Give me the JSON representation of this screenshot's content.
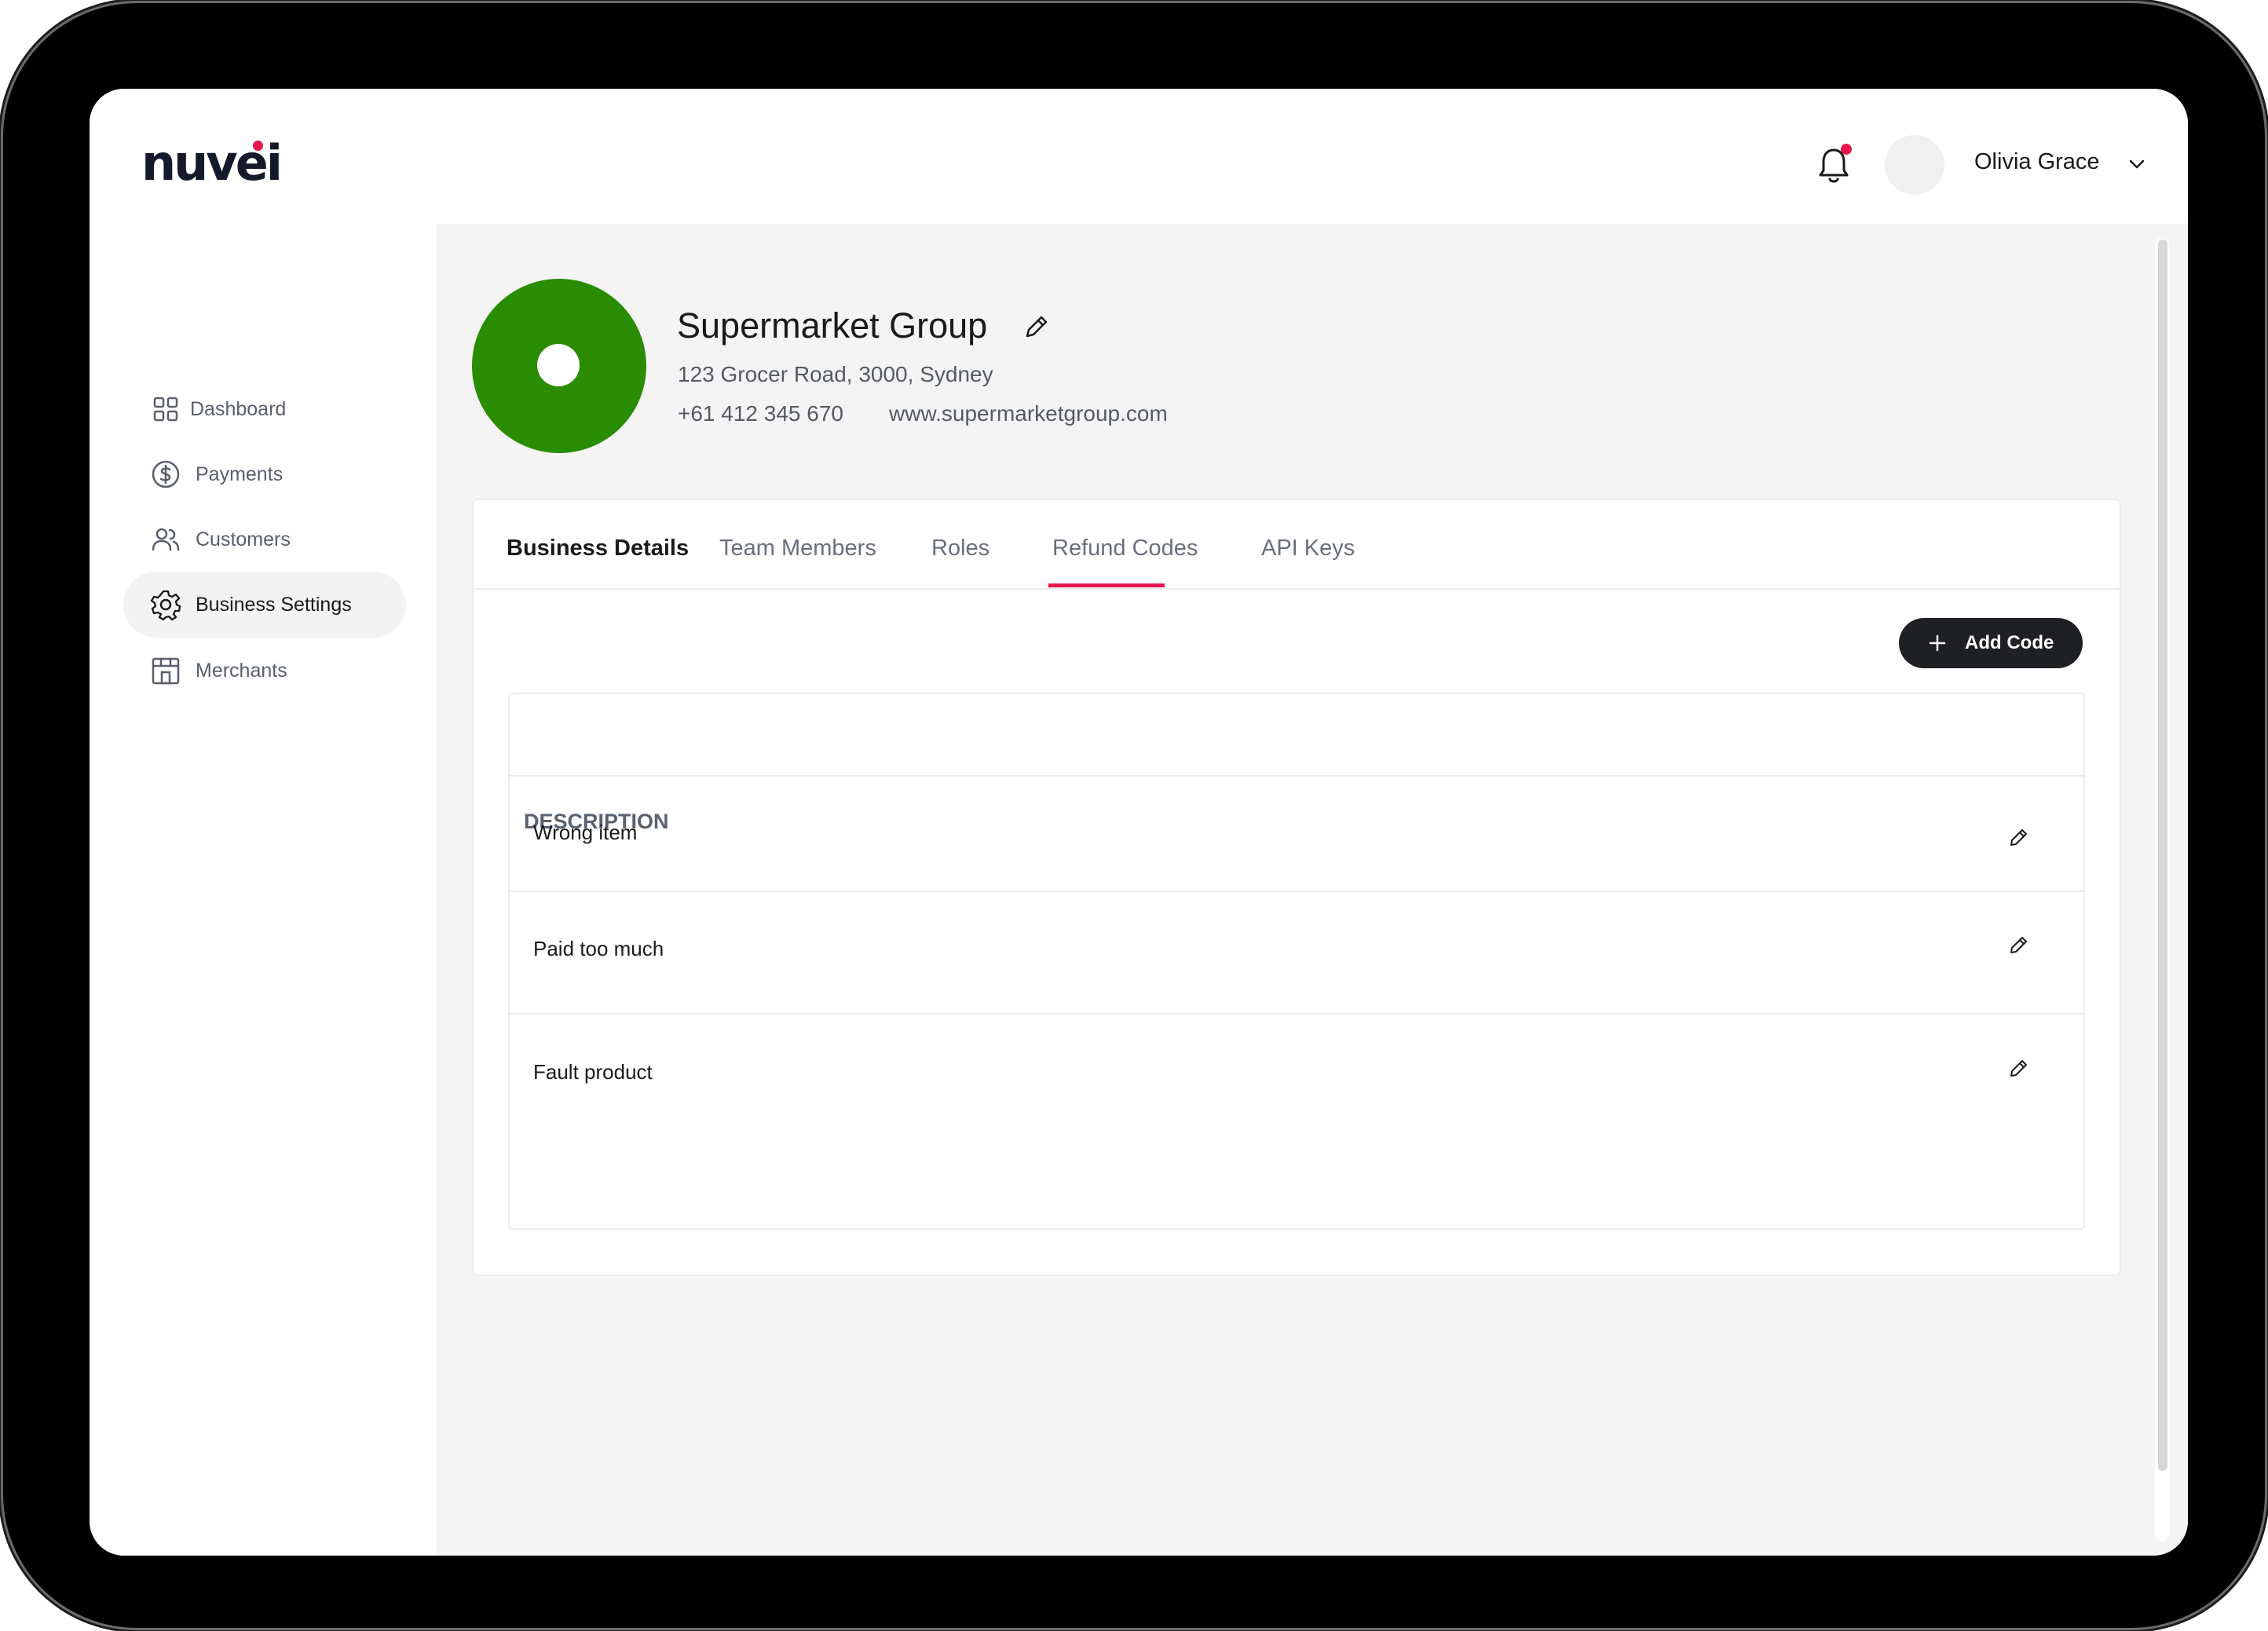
{
  "app": {
    "logo_text": "nuvei",
    "accent_color": "#e5174e",
    "brand_green": "#2a8c00"
  },
  "header": {
    "notification_icon": "bell-icon",
    "user": {
      "name": "Olivia Grace",
      "menu_icon": "chevron-down-icon"
    }
  },
  "sidebar": {
    "items": [
      {
        "label": "Dashboard",
        "icon": "grid-icon",
        "active": false
      },
      {
        "label": "Payments",
        "icon": "dollar-circle-icon",
        "active": false
      },
      {
        "label": "Customers",
        "icon": "users-icon",
        "active": false
      },
      {
        "label": "Business Settings",
        "icon": "gear-icon",
        "active": true
      },
      {
        "label": "Merchants",
        "icon": "storefront-icon",
        "active": false
      }
    ]
  },
  "business": {
    "name": "Supermarket Group",
    "address": "123 Grocer Road, 3000, Sydney",
    "phone": "+61 412 345 670",
    "website": "www.supermarketgroup.com"
  },
  "tabs": [
    {
      "label": "Business Details"
    },
    {
      "label": "Team Members"
    },
    {
      "label": "Roles"
    },
    {
      "label": "Refund Codes",
      "selected": true
    },
    {
      "label": "API Keys"
    }
  ],
  "refund_codes": {
    "add_button_label": "Add Code",
    "column_header": "DESCRIPTION",
    "rows": [
      {
        "description": "Wrong item"
      },
      {
        "description": "Paid too much"
      },
      {
        "description": "Fault product"
      }
    ]
  }
}
